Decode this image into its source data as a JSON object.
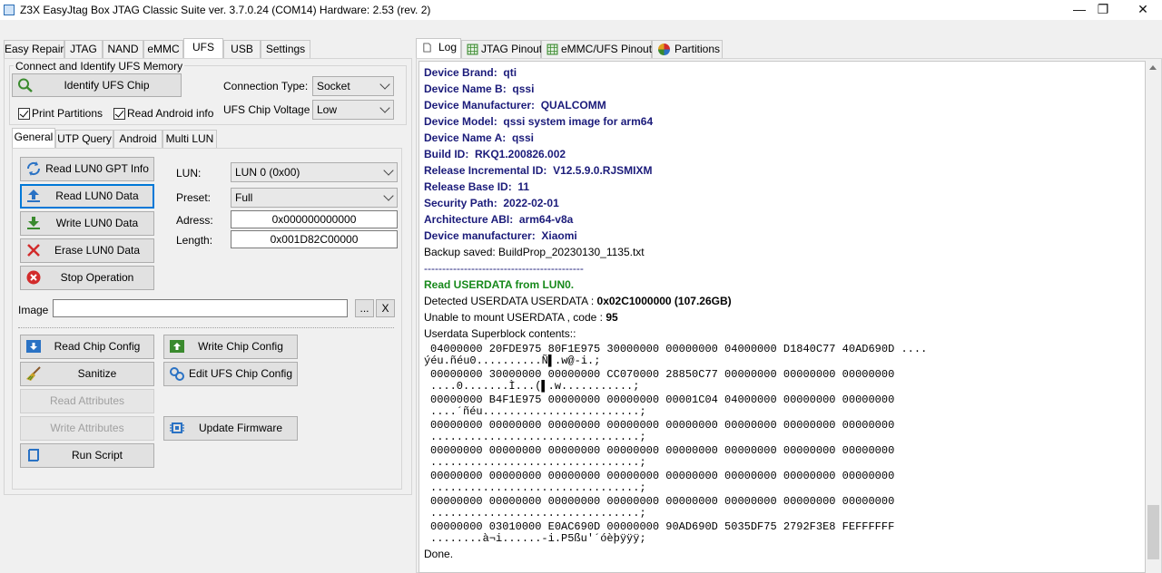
{
  "window": {
    "title": "Z3X EasyJtag Box JTAG Classic Suite ver. 3.7.0.24 (COM14) Hardware: 2.53 (rev. 2)",
    "min": "—",
    "max": "❐",
    "close": "✕"
  },
  "main_tabs": [
    "Easy Repair",
    "JTAG",
    "NAND",
    "eMMC",
    "UFS",
    "USB",
    "Settings"
  ],
  "connect": {
    "group_title": "Connect and Identify UFS Memory",
    "identify_btn": "Identify UFS Chip",
    "conn_type_label": "Connection Type:",
    "conn_type_value": "Socket",
    "voltage_label": "UFS Chip Voltage :",
    "voltage_value": "Low",
    "print_partitions": "Print Partitions",
    "read_android": "Read Android info"
  },
  "sub_tabs": [
    "General",
    "UTP Query",
    "Android",
    "Multi LUN"
  ],
  "general": {
    "buttons": [
      "Read LUN0 GPT Info",
      "Read LUN0 Data",
      "Write LUN0 Data",
      "Erase LUN0 Data",
      "Stop Operation"
    ],
    "lun_label": "LUN:",
    "lun_value": "LUN 0 (0x00)",
    "preset_label": "Preset:",
    "preset_value": "Full",
    "address_label": "Adress:",
    "address_value": "0x000000000000",
    "length_label": "Length:",
    "length_value": "0x001D82C00000",
    "image_label": "Image",
    "image_browse": "...",
    "image_clear": "X"
  },
  "tools": {
    "read_chip_config": "Read Chip Config",
    "write_chip_config": "Write Chip Config",
    "sanitize": "Sanitize",
    "edit_chip_config": "Edit UFS Chip Config",
    "read_attributes": "Read Attributes",
    "write_attributes": "Write Attributes",
    "update_firmware": "Update Firmware",
    "run_script": "Run Script"
  },
  "right_tabs": [
    "Log",
    "JTAG Pinout",
    "eMMC/UFS Pinout",
    "Partitions"
  ],
  "log": {
    "props": [
      [
        "Device Brand:",
        "qti"
      ],
      [
        "Device Name B:",
        "qssi"
      ],
      [
        "Device Manufacturer:",
        "QUALCOMM"
      ],
      [
        "Device Model:",
        "qssi system image for arm64"
      ],
      [
        "Device Name A:",
        "qssi"
      ],
      [
        "Build ID:",
        "RKQ1.200826.002"
      ],
      [
        "Release Incremental ID:",
        "V12.5.9.0.RJSMIXM"
      ],
      [
        "Release Base ID:",
        "11"
      ],
      [
        "Security Path:",
        "2022-02-01"
      ],
      [
        "Architecture ABI:",
        "arm64-v8a"
      ],
      [
        "Device manufacturer:",
        "Xiaomi"
      ]
    ],
    "backup": "Backup saved: BuildProp_20230130_1135.txt",
    "divider": "--------------------------------------------",
    "read_userdata": "Read USERDATA from LUN0.",
    "detected_prefix": "Detected USERDATA USERDATA :",
    "detected_value": "0x02C1000000 (107.26GB)",
    "mount_prefix": "Unable to mount USERDATA , code :",
    "mount_code": "95",
    "superblock": "Userdata Superblock contents::",
    "hex": [
      [
        "04000000 20FDE975 80F1E975 30000000 00000000 04000000 D1840C77 40AD690D     ....",
        "ýéu.ñéu0..........Ñ▌.w@-i.;"
      ],
      [
        "00000000 30000000 00000000 CC070000 28850C77 00000000 00000000 00000000",
        "....0.......Ì...(▌.w...........;"
      ],
      [
        "00000000 B4F1E975 00000000 00000000 00001C04 04000000 00000000 00000000",
        "....´ñéu........................;"
      ],
      [
        "00000000 00000000 00000000 00000000 00000000 00000000 00000000 00000000",
        "................................;"
      ],
      [
        "00000000 00000000 00000000 00000000 00000000 00000000 00000000 00000000",
        "................................;"
      ],
      [
        "00000000 00000000 00000000 00000000 00000000 00000000 00000000 00000000",
        "................................;"
      ],
      [
        "00000000 00000000 00000000 00000000 00000000 00000000 00000000 00000000",
        "................................;"
      ],
      [
        "00000000 03010000 E0AC690D 00000000 90AD690D 5035DF75 2792F3E8 FEFFFFFF",
        "........à¬i......-i.P5ßu'´óèþÿÿÿ;"
      ]
    ],
    "done": "Done."
  },
  "colors": {
    "accent": "#0078d7",
    "navy": "#1b1b7a",
    "green": "#17891b"
  }
}
